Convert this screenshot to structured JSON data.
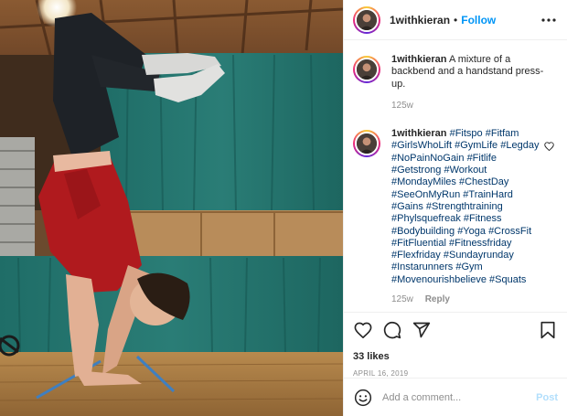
{
  "post": {
    "username": "1withkieran",
    "separator": "•",
    "follow_label": "Follow",
    "caption": {
      "username": "1withkieran",
      "text": "A mixture of a backbend and a handstand press-up.",
      "time": "125w"
    },
    "hashtag_comment": {
      "username": "1withkieran",
      "tags": [
        "#Fitspo",
        "#Fitfam",
        "#GirlsWhoLift",
        "#GymLife",
        "#Legday",
        "#NoPainNoGain",
        "#Fitlife",
        "#Getstrong",
        "#Workout",
        "#MondayMiles",
        "#ChestDay",
        "#SeeOnMyRun",
        "#TrainHard",
        "#Gains",
        "#Strengthtraining",
        "#Phylsquefreak",
        "#Fitness",
        "#Bodybuilding",
        "#Yoga",
        "#CrossFit",
        "#FitFluential",
        "#Fitnessfriday",
        "#Flexfriday",
        "#Sundayrunday",
        "#Instarunners",
        "#Gym",
        "#Movenourishbelieve",
        "#Squats"
      ],
      "time": "125w",
      "reply_label": "Reply"
    },
    "likes": "33 likes",
    "date": "APRIL 16, 2019",
    "comment_placeholder": "Add a comment...",
    "post_label": "Post",
    "icons": [
      "more-icon",
      "heart-icon",
      "comment-icon",
      "share-icon",
      "bookmark-icon",
      "emoji-icon"
    ],
    "colors": {
      "link": "#0095f6",
      "hashtag": "#00376b",
      "muted": "#8e8e8e",
      "post_disabled": "#b2dffc"
    }
  }
}
